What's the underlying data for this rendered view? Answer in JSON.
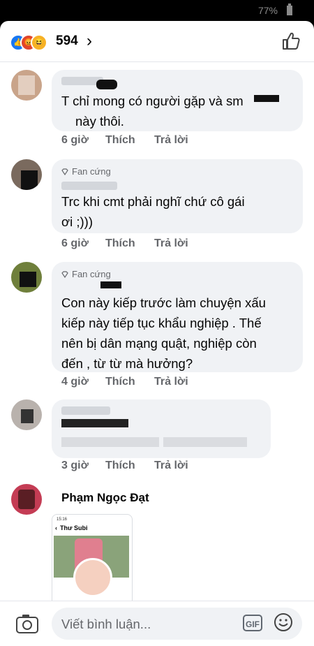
{
  "status_bar": {
    "battery": "77%"
  },
  "header": {
    "reaction_count": "594",
    "reactions": [
      "like-icon",
      "angry-icon",
      "haha-icon"
    ]
  },
  "comments": [
    {
      "badge": "",
      "text_line1": "T chỉ mong có người gặp và sm",
      "text_line2": "này thôi.",
      "time": "6 giờ",
      "like": "Thích",
      "reply": "Trả lời"
    },
    {
      "badge": "Fan cứng",
      "text_line1": "Trc khi cmt phải nghĩ chứ cô gái",
      "text_line2": "ơi ;)))",
      "time": "6 giờ",
      "like": "Thích",
      "reply": "Trả lời"
    },
    {
      "badge": "Fan cứng",
      "text_line1": "Con này kiếp trước làm chuyện xấu",
      "text_line2": "kiếp này tiếp tục khẩu nghiệp . Thế",
      "text_line3": "nên bị dân mạng quật, nghiệp còn",
      "text_line4": "đến , từ từ mà hưởng?",
      "time": "4 giờ",
      "like": "Thích",
      "reply": "Trả lời"
    },
    {
      "badge": "",
      "time": "3 giờ",
      "like": "Thích",
      "reply": "Trả lời"
    },
    {
      "name": "Phạm Ngọc Đạt",
      "preview_time": "15:16",
      "preview_title": "Thư Subi"
    }
  ],
  "composer": {
    "placeholder": "Viết bình luận...",
    "gif": "GIF"
  },
  "colors": {
    "accent": "#1877f2",
    "bubble": "#f0f2f5",
    "meta": "#65676b"
  }
}
